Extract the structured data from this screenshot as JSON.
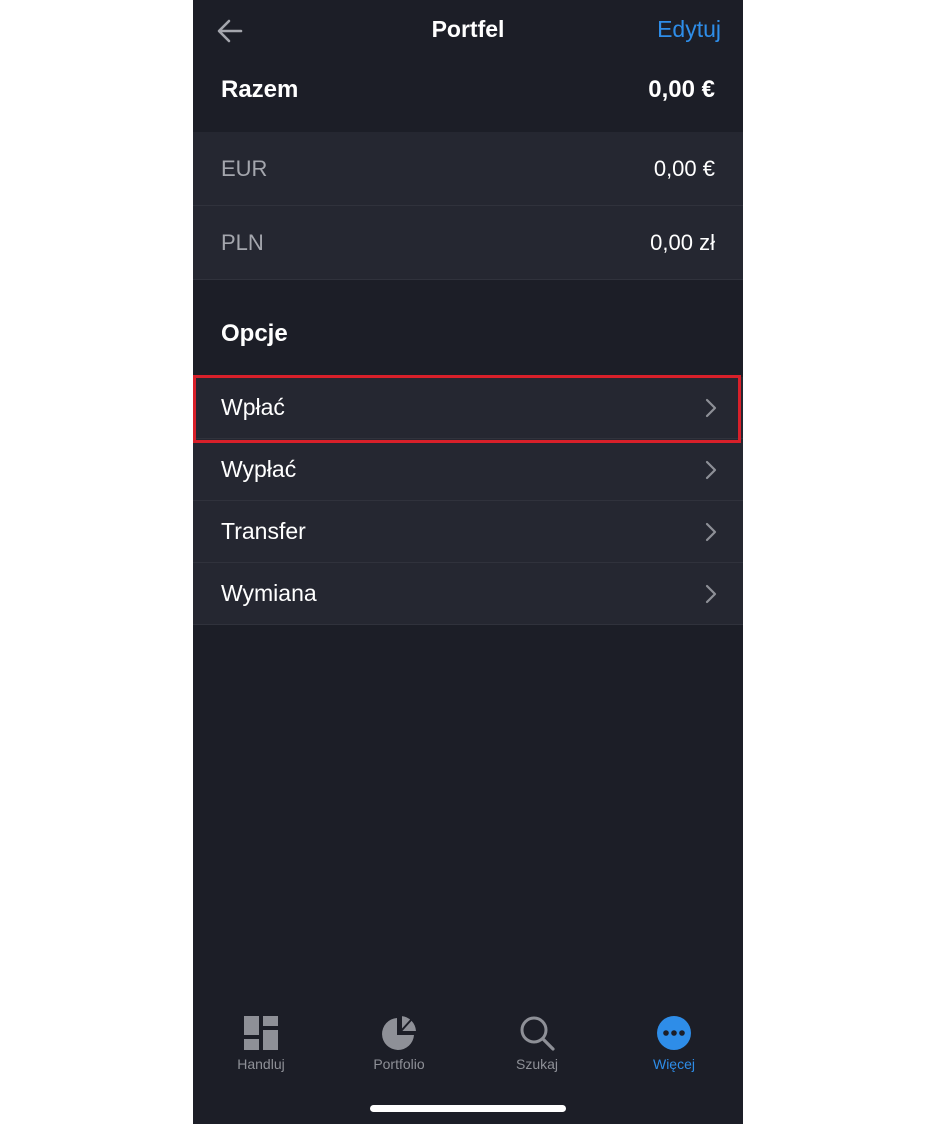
{
  "nav": {
    "title": "Portfel",
    "edit_label": "Edytuj",
    "back_icon": "arrow-left-icon"
  },
  "summary": {
    "total_label": "Razem",
    "total_value": "0,00 €"
  },
  "currencies": [
    {
      "code": "EUR",
      "value": "0,00 €"
    },
    {
      "code": "PLN",
      "value": "0,00 zł"
    }
  ],
  "options": {
    "title": "Opcje",
    "items": [
      {
        "label": "Wpłać",
        "highlighted": true
      },
      {
        "label": "Wypłać"
      },
      {
        "label": "Transfer"
      },
      {
        "label": "Wymiana"
      }
    ]
  },
  "tabbar": {
    "tabs": [
      {
        "label": "Handluj",
        "icon": "dashboard-grid-icon"
      },
      {
        "label": "Portfolio",
        "icon": "pie-chart-icon"
      },
      {
        "label": "Szukaj",
        "icon": "search-icon"
      },
      {
        "label": "Więcej",
        "icon": "more-dots-icon",
        "active": true
      }
    ]
  },
  "colors": {
    "background": "#1c1e27",
    "row_background": "#252731",
    "accent": "#2e8de8",
    "highlight_border": "#d8202a",
    "muted_text": "#8e9097"
  }
}
